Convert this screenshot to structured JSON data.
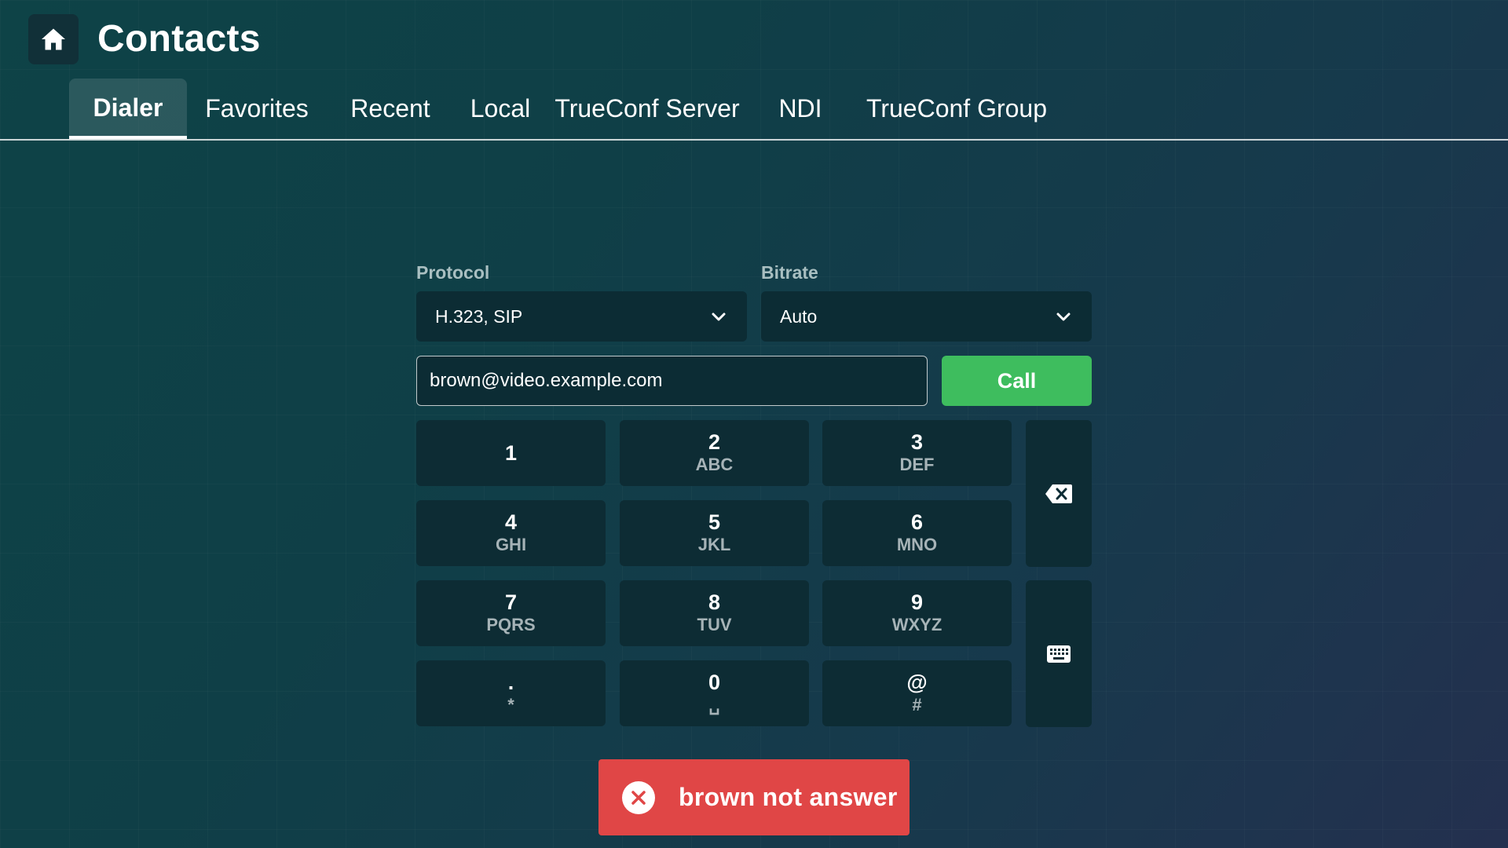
{
  "header": {
    "title": "Contacts",
    "home_icon": "home-icon"
  },
  "tabs": [
    {
      "label": "Dialer",
      "active": true
    },
    {
      "label": "Favorites",
      "active": false
    },
    {
      "label": "Recent",
      "active": false
    },
    {
      "label": "Local",
      "active": false
    },
    {
      "label": "TrueConf Server",
      "active": false
    },
    {
      "label": "NDI",
      "active": false
    },
    {
      "label": "TrueConf Group",
      "active": false
    }
  ],
  "dialer": {
    "protocol": {
      "label": "Protocol",
      "value": "H.323, SIP"
    },
    "bitrate": {
      "label": "Bitrate",
      "value": "Auto"
    },
    "address_value": "brown@video.example.com",
    "call_label": "Call",
    "keys": [
      {
        "digit": "1",
        "letters": ""
      },
      {
        "digit": "2",
        "letters": "ABC"
      },
      {
        "digit": "3",
        "letters": "DEF"
      },
      {
        "digit": "4",
        "letters": "GHI"
      },
      {
        "digit": "5",
        "letters": "JKL"
      },
      {
        "digit": "6",
        "letters": "MNO"
      },
      {
        "digit": "7",
        "letters": "PQRS"
      },
      {
        "digit": "8",
        "letters": "TUV"
      },
      {
        "digit": "9",
        "letters": "WXYZ"
      },
      {
        "digit": ".",
        "letters": "*"
      },
      {
        "digit": "0",
        "letters": "␣"
      },
      {
        "digit": "@",
        "letters": "#"
      }
    ],
    "backspace_icon": "backspace-icon",
    "keyboard_icon": "keyboard-icon"
  },
  "toast": {
    "message": "brown not answer",
    "icon": "error-icon",
    "color": "#e04646"
  },
  "colors": {
    "accent_call": "#3ebd5e",
    "error": "#e04646"
  }
}
